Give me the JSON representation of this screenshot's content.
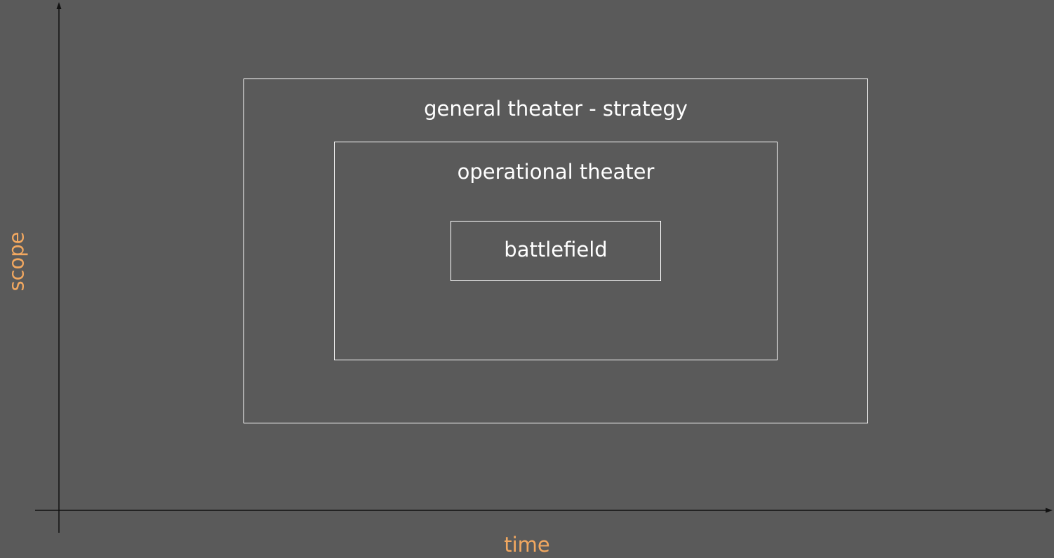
{
  "diagram": {
    "boxes": {
      "general": "general theater - strategy",
      "operational": "operational theater",
      "battlefield": "battlefield"
    },
    "axes": {
      "x_label": "time",
      "y_label": "scope"
    },
    "colors": {
      "background": "#5a5a5a",
      "box_stroke": "#ffffff",
      "box_text": "#ffffff",
      "axis_line": "#111111",
      "axis_label": "#f2a860"
    }
  }
}
